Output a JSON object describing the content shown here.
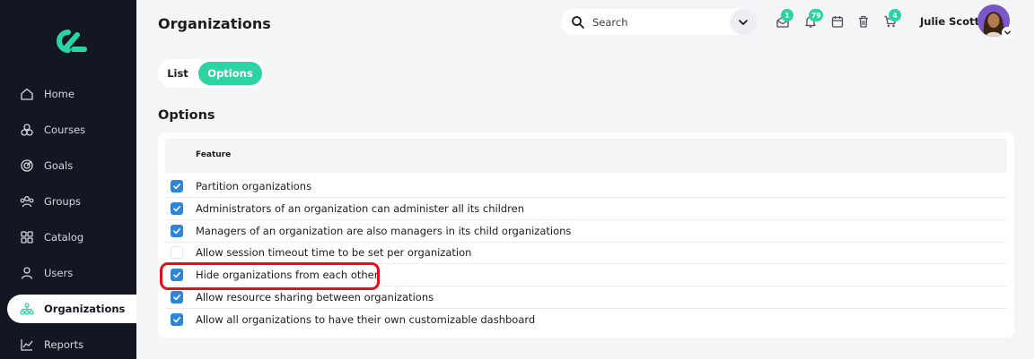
{
  "sidebar": {
    "items": [
      {
        "label": "Home",
        "icon": "home-icon",
        "active": false
      },
      {
        "label": "Courses",
        "icon": "courses-icon",
        "active": false
      },
      {
        "label": "Goals",
        "icon": "goals-icon",
        "active": false
      },
      {
        "label": "Groups",
        "icon": "groups-icon",
        "active": false
      },
      {
        "label": "Catalog",
        "icon": "catalog-icon",
        "active": false
      },
      {
        "label": "Users",
        "icon": "users-icon",
        "active": false
      },
      {
        "label": "Organizations",
        "icon": "organizations-icon",
        "active": true
      },
      {
        "label": "Reports",
        "icon": "reports-icon",
        "active": false
      }
    ]
  },
  "header": {
    "title": "Organizations",
    "search_placeholder": "Search",
    "badges": {
      "messages": "1",
      "notifications": "79",
      "cart": "4"
    },
    "user_name": "Julie Scott"
  },
  "tabs": [
    {
      "label": "List",
      "active": false
    },
    {
      "label": "Options",
      "active": true
    }
  ],
  "section_title": "Options",
  "table": {
    "column_header": "Feature",
    "rows": [
      {
        "label": "Partition organizations",
        "checked": true
      },
      {
        "label": "Administrators of an organization can administer all its children",
        "checked": true
      },
      {
        "label": "Managers of an organization are also managers in its child organizations",
        "checked": true
      },
      {
        "label": "Allow session timeout time to be set per organization",
        "checked": false
      },
      {
        "label": "Hide organizations from each other",
        "checked": true
      },
      {
        "label": "Allow resource sharing between organizations",
        "checked": true
      },
      {
        "label": "Allow all organizations to have their own customizable dashboard",
        "checked": true
      }
    ]
  },
  "colors": {
    "accent": "#2ed3a4",
    "sidebar_bg": "#131722",
    "checkbox": "#2f86d8",
    "highlight": "#e0101a"
  }
}
